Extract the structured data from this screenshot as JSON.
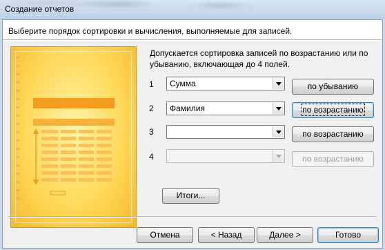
{
  "window": {
    "title": "Создание отчетов"
  },
  "instruction": "Выберите порядок сортировки и вычисления, выполняемые для записей.",
  "description": "Допускается сортировка записей по возрастанию или по убыванию, включающая до 4 полей.",
  "sort_rows": [
    {
      "number": "1",
      "field": "Сумма",
      "order": "по убыванию",
      "enabled": true
    },
    {
      "number": "2",
      "field": "Фамилия",
      "order": "по возрастанию",
      "enabled": true
    },
    {
      "number": "3",
      "field": "",
      "order": "по возрастанию",
      "enabled": true
    },
    {
      "number": "4",
      "field": "",
      "order": "по возрастанию",
      "enabled": false
    }
  ],
  "summary_button": "Итоги...",
  "footer": {
    "cancel": "Отмена",
    "back": "< Назад",
    "next": "Далее >",
    "finish": "Готово"
  },
  "colors": {
    "illustration_fill": "#ffd95a",
    "illustration_bar": "#f39c1e",
    "focus_border": "#3c7fb1"
  }
}
